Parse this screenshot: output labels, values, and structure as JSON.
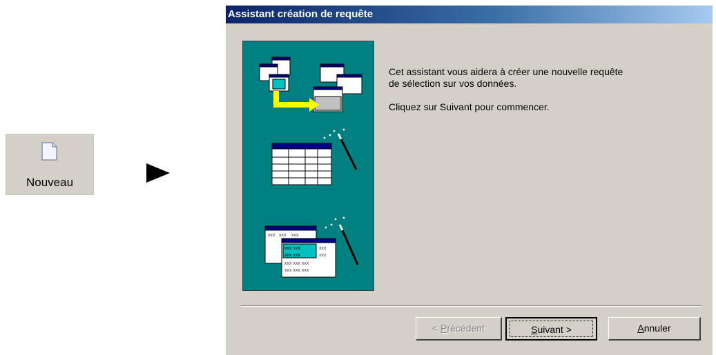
{
  "toolbar": {
    "new_label": "Nouveau"
  },
  "dialog": {
    "title": "Assistant création de requête",
    "intro_line1": "Cet assistant vous aidera à créer une nouvelle requête",
    "intro_line2": "de sélection sur vos données.",
    "intro_line3": "Cliquez sur Suivant pour commencer.",
    "buttons": {
      "prev_prefix": "< ",
      "prev_hotkey": "P",
      "prev_rest": "récédent",
      "next_hotkey": "S",
      "next_rest": "uivant >",
      "cancel_hotkey": "A",
      "cancel_rest": "nnuler"
    }
  },
  "icons": [
    "document-icon",
    "arrow-right-icon",
    "tables-join-icon",
    "table-wizard-icon",
    "crosstab-wizard-icon"
  ],
  "colors": {
    "panel": "#008080",
    "title_start": "#0a246a",
    "title_end": "#a6caf0",
    "face": "#d4d0c8"
  },
  "grid_text": "xxx"
}
